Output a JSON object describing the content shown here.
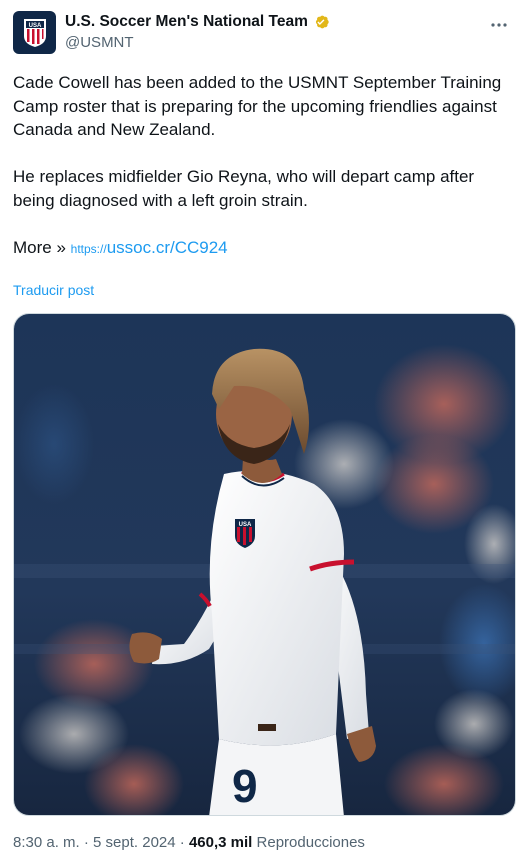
{
  "author": {
    "display_name": "U.S. Soccer Men's National Team",
    "handle": "@USMNT",
    "avatar_text": "USA",
    "verified": true,
    "verified_color": "#e2b719"
  },
  "tweet": {
    "paragraph1": "Cade Cowell has been added to the USMNT September Training Camp roster that is preparing for the upcoming friendlies against Canada and New Zealand.",
    "paragraph2": "He replaces midfielder Gio Reyna, who will depart camp after being diagnosed with a left groin strain.",
    "more_label": "More »",
    "link_protocol": "https://",
    "link_text": "ussoc.cr/CC924",
    "translate_label": "Traducir post"
  },
  "media": {
    "jersey_number": "9",
    "crest_text": "USA"
  },
  "meta": {
    "time": "8:30 a. m.",
    "separator1": "·",
    "date": "5 sept. 2024",
    "separator2": "·",
    "views_count": "460,3 mil",
    "views_label": "Reproducciones"
  },
  "colors": {
    "link": "#1d9bf0",
    "secondary_text": "#536471",
    "primary_text": "#0f1419"
  }
}
